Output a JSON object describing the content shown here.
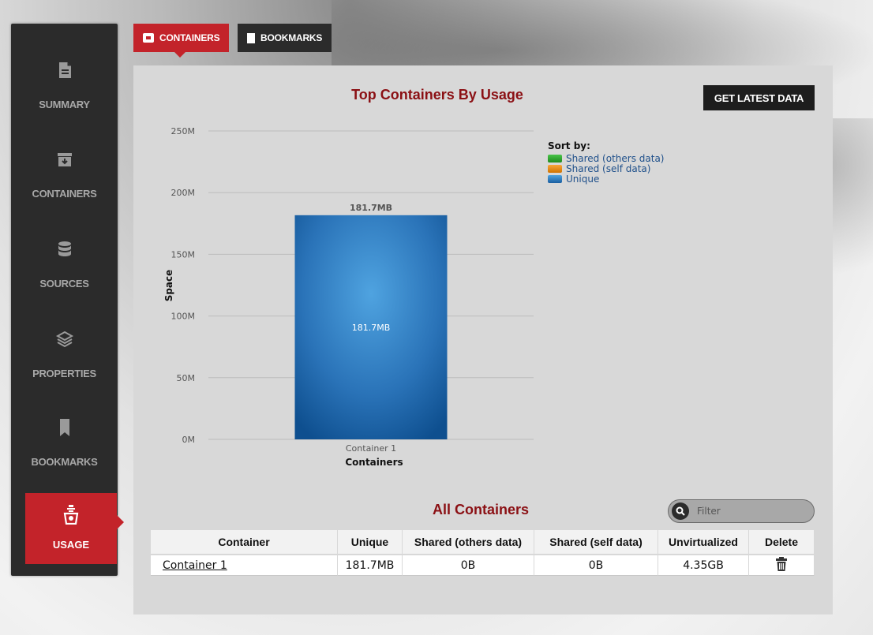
{
  "tabs": {
    "containers": "CONTAINERS",
    "bookmarks": "BOOKMARKS"
  },
  "sidebar": {
    "items": [
      {
        "label": "SUMMARY",
        "icon": "document-icon"
      },
      {
        "label": "CONTAINERS",
        "icon": "archive-box-icon"
      },
      {
        "label": "SOURCES",
        "icon": "database-icon"
      },
      {
        "label": "PROPERTIES",
        "icon": "layers-icon"
      },
      {
        "label": "BOOKMARKS",
        "icon": "bookmark-icon"
      },
      {
        "label": "USAGE",
        "icon": "usage-icon",
        "active": true
      }
    ]
  },
  "chart": {
    "title": "Top Containers By Usage",
    "refresh_label": "GET LATEST DATA",
    "legend_title": "Sort by:"
  },
  "chart_data": {
    "type": "bar",
    "stacked": true,
    "categories": [
      "Container 1"
    ],
    "series": [
      {
        "name": "Shared (others data)",
        "color": "#2fa02f",
        "values": [
          0
        ]
      },
      {
        "name": "Shared (self data)",
        "color": "#e88a10",
        "values": [
          0
        ]
      },
      {
        "name": "Unique",
        "color": "#2a73b8",
        "values": [
          181.7
        ]
      }
    ],
    "bar_labels": [
      "181.7MB"
    ],
    "total_labels": [
      "181.7MB"
    ],
    "xlabel": "Containers",
    "ylabel": "Space",
    "yticks": [
      "0M",
      "50M",
      "100M",
      "150M",
      "200M",
      "250M"
    ],
    "ylim": [
      0,
      250
    ],
    "grid": true,
    "legend_position": "top-right"
  },
  "table": {
    "title": "All Containers",
    "filter_placeholder": "Filter",
    "headers": [
      "Container",
      "Unique",
      "Shared (others data)",
      "Shared (self data)",
      "Unvirtualized",
      "Delete"
    ],
    "rows": [
      {
        "name": "Container 1",
        "unique": "181.7MB",
        "shared_others": "0B",
        "shared_self": "0B",
        "unvirtualized": "4.35GB"
      }
    ]
  }
}
